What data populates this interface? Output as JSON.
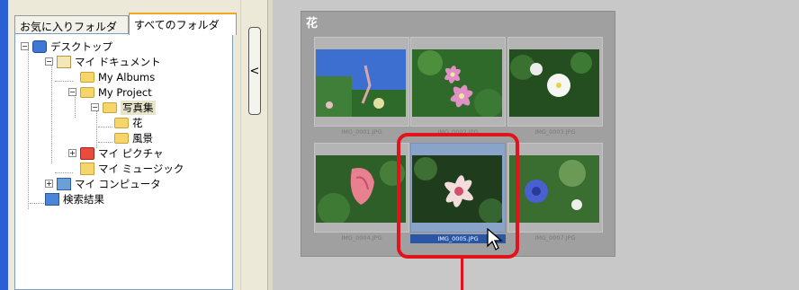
{
  "tabs": [
    {
      "label": "お気に入りフォルダ"
    },
    {
      "label": "すべてのフォルダ"
    }
  ],
  "tree": {
    "items": [
      {
        "label": "デスクトップ",
        "icon": "desktop-icon",
        "expander": "⊟"
      },
      {
        "label": "マイ ドキュメント",
        "icon": "my-documents-icon",
        "expander": "⊟"
      },
      {
        "label": "My Albums",
        "icon": "folder-icon"
      },
      {
        "label": "My Project",
        "icon": "folder-icon",
        "expander": "⊟"
      },
      {
        "label": "写真集",
        "icon": "folder-icon",
        "expander": "⊟",
        "selected": true
      },
      {
        "label": "花",
        "icon": "folder-icon"
      },
      {
        "label": "風景",
        "icon": "folder-icon"
      },
      {
        "label": "マイ ピクチャ",
        "icon": "my-pictures-icon",
        "expander": "⊞"
      },
      {
        "label": "マイ ミュージック",
        "icon": "my-music-icon"
      },
      {
        "label": "マイ コンピュータ",
        "icon": "my-computer-icon",
        "expander": "⊞"
      },
      {
        "label": "検索結果",
        "icon": "search-results-icon"
      }
    ]
  },
  "collapse_button": {
    "glyph": "<"
  },
  "gallery": {
    "title": "花",
    "thumbnails": [
      {
        "filename": "IMG_0001.JPG"
      },
      {
        "filename": "IMG_0002.JPG"
      },
      {
        "filename": "IMG_0003.JPG"
      },
      {
        "filename": "IMG_0004.JPG"
      },
      {
        "filename": "IMG_0005.JPG",
        "selected": true
      },
      {
        "filename": "IMG_0007.JPG"
      }
    ]
  },
  "colors": {
    "highlight": "#e3131b",
    "app_edge": "#2b5fd6"
  }
}
